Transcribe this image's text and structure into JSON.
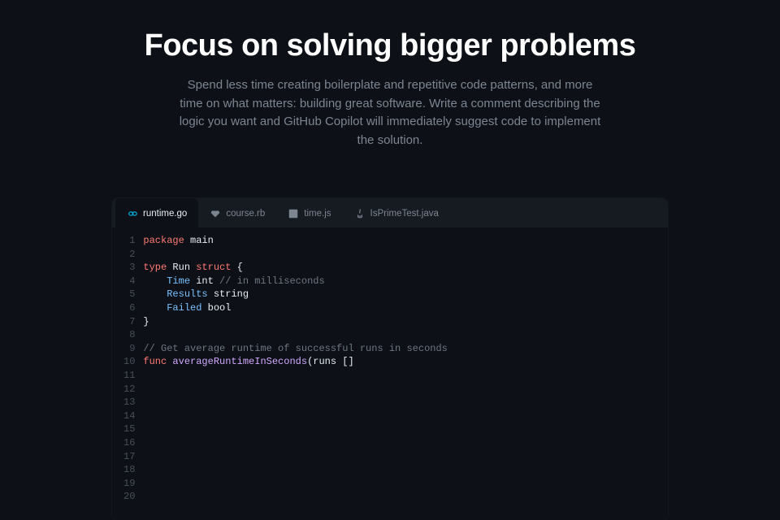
{
  "hero": {
    "title": "Focus on solving bigger problems",
    "subtitle": "Spend less time creating boilerplate and repetitive code patterns, and more time on what matters: building great software. Write a comment describing the logic you want and GitHub Copilot will immediately suggest code to implement the solution."
  },
  "tabs": [
    {
      "label": "runtime.go",
      "icon": "go-icon",
      "active": true
    },
    {
      "label": "course.rb",
      "icon": "ruby-icon",
      "active": false
    },
    {
      "label": "time.js",
      "icon": "js-icon",
      "active": false
    },
    {
      "label": "IsPrimeTest.java",
      "icon": "java-icon",
      "active": false
    }
  ],
  "code": {
    "line_count": 20,
    "lines": [
      [
        {
          "t": "tok-k",
          "v": "package"
        },
        {
          "t": "tok-n",
          "v": " main"
        }
      ],
      [],
      [
        {
          "t": "tok-k",
          "v": "type"
        },
        {
          "t": "tok-n",
          "v": " Run "
        },
        {
          "t": "tok-k",
          "v": "struct"
        },
        {
          "t": "tok-p",
          "v": " {"
        }
      ],
      [
        {
          "t": "tok-n",
          "v": "    "
        },
        {
          "t": "tok-t",
          "v": "Time"
        },
        {
          "t": "tok-n",
          "v": " int "
        },
        {
          "t": "tok-c",
          "v": "// in milliseconds"
        }
      ],
      [
        {
          "t": "tok-n",
          "v": "    "
        },
        {
          "t": "tok-t",
          "v": "Results"
        },
        {
          "t": "tok-n",
          "v": " string"
        }
      ],
      [
        {
          "t": "tok-n",
          "v": "    "
        },
        {
          "t": "tok-t",
          "v": "Failed"
        },
        {
          "t": "tok-n",
          "v": " bool"
        }
      ],
      [
        {
          "t": "tok-p",
          "v": "}"
        }
      ],
      [],
      [
        {
          "t": "tok-c",
          "v": "// Get average runtime of successful runs in seconds"
        }
      ],
      [
        {
          "t": "tok-k",
          "v": "func"
        },
        {
          "t": "tok-n",
          "v": " "
        },
        {
          "t": "tok-f",
          "v": "averageRuntimeInSeconds"
        },
        {
          "t": "tok-p",
          "v": "(runs []"
        }
      ],
      [],
      [],
      [],
      [],
      [],
      [],
      [],
      [],
      [],
      []
    ]
  }
}
